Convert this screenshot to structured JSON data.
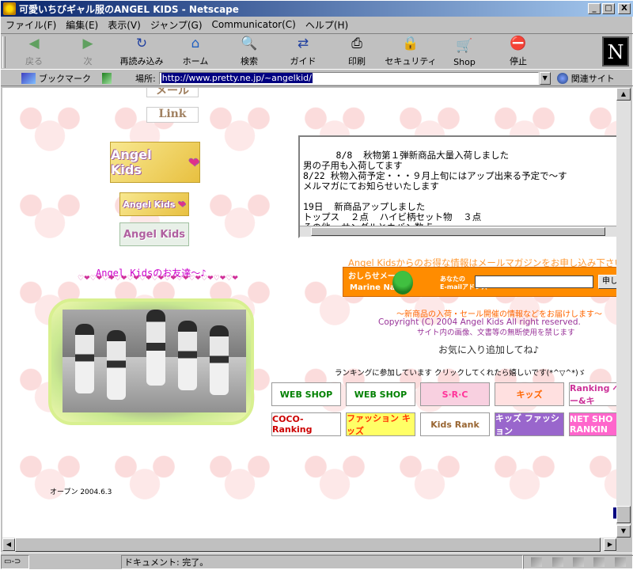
{
  "window": {
    "title": "可愛いちびギャル服のANGEL KIDS - Netscape",
    "minimize": "_",
    "maximize": "□",
    "close": "X"
  },
  "menu": {
    "items": [
      "ファイル(F)",
      "編集(E)",
      "表示(V)",
      "ジャンプ(G)",
      "Communicator(C)",
      "ヘルプ(H)"
    ]
  },
  "toolbar": {
    "buttons": [
      {
        "label": "戻る",
        "icon": "back-arrow-icon",
        "glyph": "◀"
      },
      {
        "label": "次",
        "icon": "forward-arrow-icon",
        "glyph": "▶"
      },
      {
        "label": "再読み込み",
        "icon": "reload-icon",
        "glyph": "↻"
      },
      {
        "label": "ホーム",
        "icon": "home-icon",
        "glyph": "⌂"
      },
      {
        "label": "検索",
        "icon": "search-icon",
        "glyph": "🔍"
      },
      {
        "label": "ガイド",
        "icon": "guide-icon",
        "glyph": "⇄"
      },
      {
        "label": "印刷",
        "icon": "print-icon",
        "glyph": "⎙"
      },
      {
        "label": "セキュリティ",
        "icon": "lock-icon",
        "glyph": "🔒"
      },
      {
        "label": "Shop",
        "icon": "shop-icon",
        "glyph": "🛒"
      },
      {
        "label": "停止",
        "icon": "stop-icon",
        "glyph": "⛔"
      }
    ],
    "logo": "N"
  },
  "location": {
    "bookmarks": "ブックマーク",
    "label": "場所:",
    "url": "http://www.pretty.ne.jp/~angelkid/",
    "related": "関連サイト"
  },
  "page": {
    "mail_link": "メール",
    "link_link": "Link",
    "banner_text": "Angel Kids",
    "friends_title": "Angel Kidsのお友達～♪",
    "hearts": "♡❤♡❤♡❤♡❤♡❤♡❤♡❤♡❤♡❤♡❤♡❤♡❤♡❤",
    "news": "8/8  秋物第１弾新商品大量入荷しました\n男の子用も入荷してます\n8/22 秋物入荷予定・・・９月上旬にはアップ出来る予定で～す\nメルマガにてお知らせいたします\n\n19日  新商品アップしました\nトップス  ２点  ハイビ柄セット物  ３点\nその他  サンダルとカバン数点",
    "magazine_heading": "Angel Kidsからのお得な情報はメールマガジンをお申し込み下さい",
    "magazine": {
      "badge1": "おしらせメール",
      "badge2": "Marine Navi",
      "addr_label": "あなたの\nE-mailアドレス",
      "email_value": "",
      "submit": "申し"
    },
    "notice": "～新商品の入荷・セール開催の情報などをお届けします～",
    "copyright": "Copyright (C) 2004 Angel Kids  All right reserved.",
    "nocopy": "サイト内の画像、文書等の無断使用を禁じます",
    "favorite": "お気に入り追加してね♪",
    "rank_intro": "ランキングに参加しています  クリックしてくれたら嬉しいです(*^▽^*)ゞ",
    "rank_banners": [
      {
        "label": "WEB SHOP",
        "bg": "#ffffff",
        "fg": "#008000"
      },
      {
        "label": "WEB SHOP",
        "bg": "#ffffff",
        "fg": "#008000"
      },
      {
        "label": "S·R·C",
        "bg": "#f8d0e0",
        "fg": "#ff3399"
      },
      {
        "label": "キッズ",
        "bg": "#ffe0e0",
        "fg": "#ff6600"
      },
      {
        "label": "Ranking ベビー&キ",
        "bg": "#ffffff",
        "fg": "#cc3399"
      },
      {
        "label": "COCO-Ranking",
        "bg": "#ffffff",
        "fg": "#cc0000"
      },
      {
        "label": "ファッション キッズ",
        "bg": "#ffff66",
        "fg": "#ff3300"
      },
      {
        "label": "Kids Rank",
        "bg": "#ffffff",
        "fg": "#996633"
      },
      {
        "label": "キッズ ファッション",
        "bg": "#9966cc",
        "fg": "#ffffff"
      },
      {
        "label": "NET SHO RANKIN",
        "bg": "#ff66cc",
        "fg": "#ffffff"
      }
    ],
    "opened": "オープン  2004.6.3"
  },
  "status": {
    "message": "ドキュメント: 完了。"
  }
}
